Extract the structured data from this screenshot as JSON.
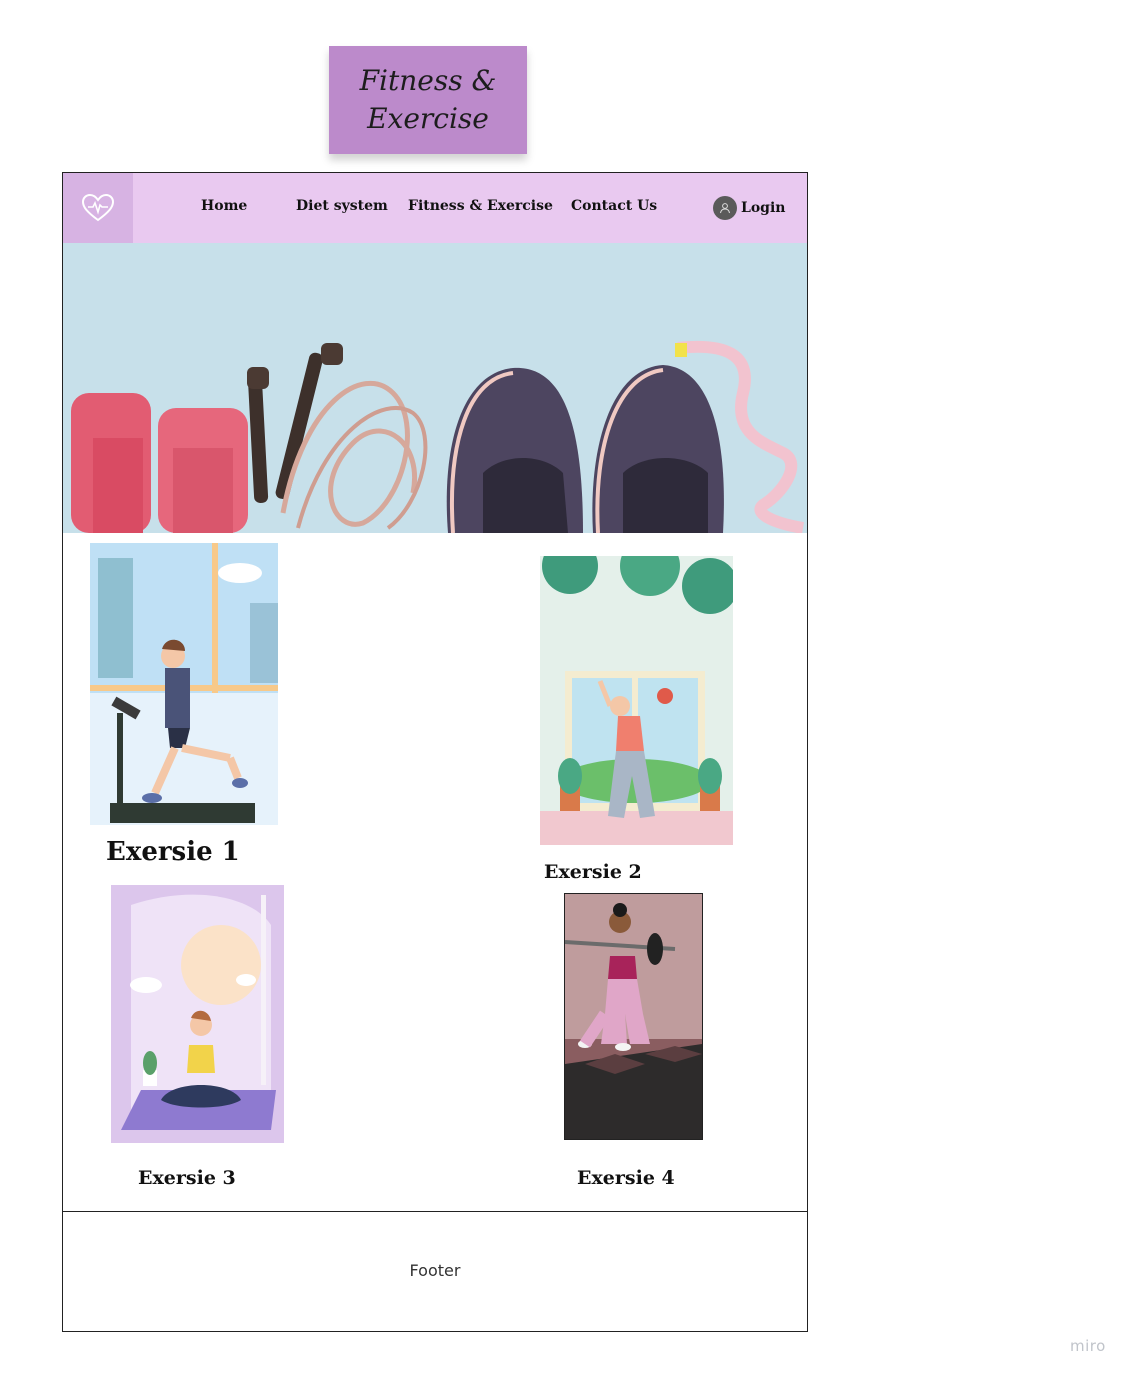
{
  "sticky_note": {
    "line1": "Fitness &",
    "line2": "Exercise",
    "color": "#bc8acb"
  },
  "navbar": {
    "logo_icon": "heart-pulse-icon",
    "links": [
      "Home",
      "Diet system",
      "Fitness & Exercise",
      "Contact Us"
    ],
    "login_label": "Login",
    "login_icon": "user-icon",
    "background": "#e9c9f0"
  },
  "hero": {
    "image": "fitness-equipment-banner",
    "items": [
      "dumbbells",
      "jump-rope",
      "sneakers",
      "measuring-tape"
    ]
  },
  "exercises": [
    {
      "label": "Exersie 1",
      "image": "treadmill-running-illustration"
    },
    {
      "label": "Exersie 2",
      "image": "stretching-illustration"
    },
    {
      "label": "Exersie 3",
      "image": "meditation-illustration"
    },
    {
      "label": "Exersie 4",
      "image": "barbell-lunge-illustration"
    }
  ],
  "footer": {
    "label": "Footer"
  },
  "watermark": "miro"
}
